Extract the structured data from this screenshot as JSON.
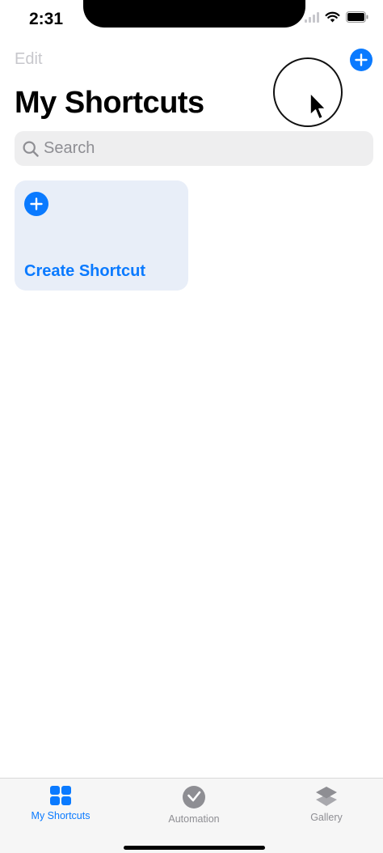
{
  "status_bar": {
    "time": "2:31"
  },
  "nav": {
    "edit_label": "Edit"
  },
  "page": {
    "title": "My Shortcuts"
  },
  "search": {
    "placeholder": "Search"
  },
  "create_card": {
    "label": "Create Shortcut"
  },
  "tabs": [
    {
      "label": "My Shortcuts",
      "icon": "grid-icon",
      "active": true
    },
    {
      "label": "Automation",
      "icon": "clock-check-icon",
      "active": false
    },
    {
      "label": "Gallery",
      "icon": "layers-icon",
      "active": false
    }
  ],
  "colors": {
    "accent": "#0a7aff",
    "inactive": "#8e8e93",
    "card_background": "#e8eef8",
    "search_background": "#eeeeef"
  }
}
